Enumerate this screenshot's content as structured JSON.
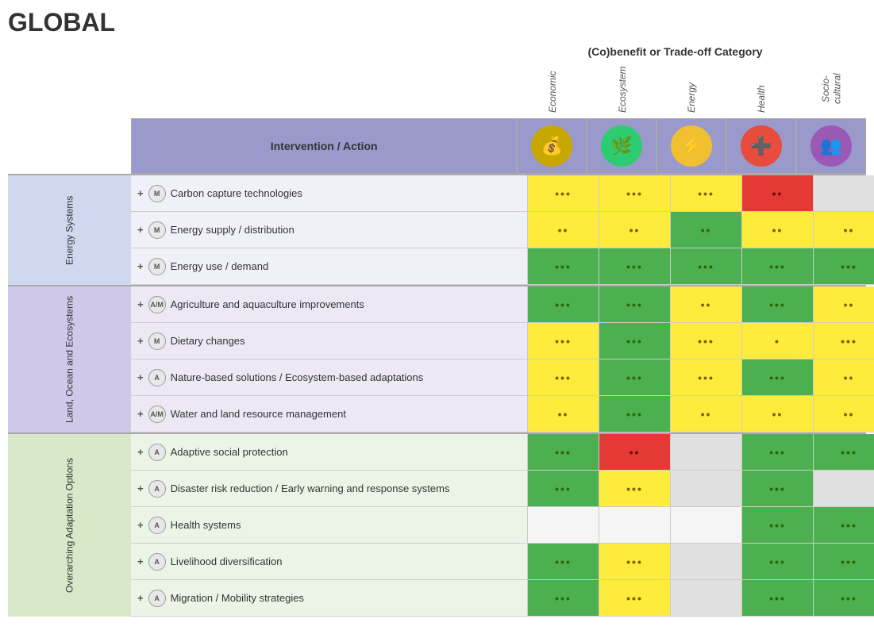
{
  "title": "GLOBAL",
  "cobenefit_label": "(Co)benefit or Trade-off Category",
  "col_headers": [
    "Economic",
    "Ecosystem",
    "Energy",
    "Health",
    "Socio-\ncultural"
  ],
  "header_row": {
    "action_label": "Intervention / Action",
    "icons": [
      "💰",
      "🌿",
      "⚡",
      "➕",
      "👥"
    ]
  },
  "sections": [
    {
      "label": "Energy Systems",
      "class": "section-energy",
      "action_class": "",
      "rows": [
        {
          "plus": "+",
          "badge": "M",
          "action": "Carbon capture technologies",
          "cells": [
            {
              "dots": "•••",
              "class": "cell-yellow"
            },
            {
              "dots": "•••",
              "class": "cell-yellow"
            },
            {
              "dots": "•••",
              "class": "cell-yellow"
            },
            {
              "dots": "••",
              "class": "cell-red"
            },
            {
              "dots": "",
              "class": "cell-gray"
            }
          ]
        },
        {
          "plus": "+",
          "badge": "M",
          "action": "Energy supply / distribution",
          "cells": [
            {
              "dots": "••",
              "class": "cell-yellow"
            },
            {
              "dots": "••",
              "class": "cell-yellow"
            },
            {
              "dots": "••",
              "class": "cell-green-dark"
            },
            {
              "dots": "••",
              "class": "cell-yellow"
            },
            {
              "dots": "••",
              "class": "cell-yellow"
            }
          ]
        },
        {
          "plus": "+",
          "badge": "M",
          "action": "Energy use / demand",
          "cells": [
            {
              "dots": "•••",
              "class": "cell-green-dark"
            },
            {
              "dots": "•••",
              "class": "cell-green-dark"
            },
            {
              "dots": "•••",
              "class": "cell-green-dark"
            },
            {
              "dots": "•••",
              "class": "cell-green-dark"
            },
            {
              "dots": "•••",
              "class": "cell-green-dark"
            }
          ]
        }
      ]
    },
    {
      "label": "Land, Ocean and Ecosystems",
      "class": "section-land",
      "action_class": "action-cell-land",
      "rows": [
        {
          "plus": "+",
          "badge": "A/M",
          "action": "Agriculture and aquaculture improvements",
          "cells": [
            {
              "dots": "•••",
              "class": "cell-green-dark"
            },
            {
              "dots": "•••",
              "class": "cell-green-dark"
            },
            {
              "dots": "••",
              "class": "cell-yellow"
            },
            {
              "dots": "•••",
              "class": "cell-green-dark"
            },
            {
              "dots": "••",
              "class": "cell-yellow"
            }
          ]
        },
        {
          "plus": "+",
          "badge": "M",
          "action": "Dietary changes",
          "cells": [
            {
              "dots": "•••",
              "class": "cell-yellow"
            },
            {
              "dots": "•••",
              "class": "cell-green-dark"
            },
            {
              "dots": "•••",
              "class": "cell-yellow"
            },
            {
              "dots": "•",
              "class": "cell-yellow"
            },
            {
              "dots": "•••",
              "class": "cell-yellow"
            }
          ]
        },
        {
          "plus": "+",
          "badge": "A",
          "action": "Nature-based solutions / Ecosystem-based adaptations",
          "cells": [
            {
              "dots": "•••",
              "class": "cell-yellow"
            },
            {
              "dots": "•••",
              "class": "cell-green-dark"
            },
            {
              "dots": "•••",
              "class": "cell-yellow"
            },
            {
              "dots": "•••",
              "class": "cell-green-dark"
            },
            {
              "dots": "••",
              "class": "cell-yellow"
            }
          ]
        },
        {
          "plus": "+",
          "badge": "A/M",
          "action": "Water and land resource management",
          "cells": [
            {
              "dots": "••",
              "class": "cell-yellow"
            },
            {
              "dots": "•••",
              "class": "cell-green-dark"
            },
            {
              "dots": "••",
              "class": "cell-yellow"
            },
            {
              "dots": "••",
              "class": "cell-yellow"
            },
            {
              "dots": "••",
              "class": "cell-yellow"
            }
          ]
        }
      ]
    },
    {
      "label": "Overarching Adaptation Options",
      "class": "section-overarching",
      "action_class": "action-cell-overarching",
      "rows": [
        {
          "plus": "+",
          "badge": "A",
          "action": "Adaptive social protection",
          "cells": [
            {
              "dots": "•••",
              "class": "cell-green-dark"
            },
            {
              "dots": "••",
              "class": "cell-red"
            },
            {
              "dots": "",
              "class": "cell-gray"
            },
            {
              "dots": "•••",
              "class": "cell-green-dark"
            },
            {
              "dots": "•••",
              "class": "cell-green-dark"
            }
          ]
        },
        {
          "plus": "+",
          "badge": "A",
          "action": "Disaster risk reduction / Early warning and response systems",
          "cells": [
            {
              "dots": "•••",
              "class": "cell-green-dark"
            },
            {
              "dots": "•••",
              "class": "cell-yellow"
            },
            {
              "dots": "",
              "class": "cell-gray"
            },
            {
              "dots": "•••",
              "class": "cell-green-dark"
            },
            {
              "dots": "",
              "class": "cell-gray"
            }
          ]
        },
        {
          "plus": "+",
          "badge": "A",
          "action": "Health systems",
          "cells": [
            {
              "dots": "",
              "class": "cell-empty"
            },
            {
              "dots": "",
              "class": "cell-empty"
            },
            {
              "dots": "",
              "class": "cell-empty"
            },
            {
              "dots": "•••",
              "class": "cell-green-dark"
            },
            {
              "dots": "•••",
              "class": "cell-green-dark"
            }
          ]
        },
        {
          "plus": "+",
          "badge": "A",
          "action": "Livelihood diversification",
          "cells": [
            {
              "dots": "•••",
              "class": "cell-green-dark"
            },
            {
              "dots": "•••",
              "class": "cell-yellow"
            },
            {
              "dots": "",
              "class": "cell-gray"
            },
            {
              "dots": "•••",
              "class": "cell-green-dark"
            },
            {
              "dots": "•••",
              "class": "cell-green-dark"
            }
          ]
        },
        {
          "plus": "+",
          "badge": "A",
          "action": "Migration / Mobility strategies",
          "cells": [
            {
              "dots": "•••",
              "class": "cell-green-dark"
            },
            {
              "dots": "•••",
              "class": "cell-yellow"
            },
            {
              "dots": "",
              "class": "cell-gray"
            },
            {
              "dots": "•••",
              "class": "cell-green-dark"
            },
            {
              "dots": "•••",
              "class": "cell-green-dark"
            }
          ]
        }
      ]
    }
  ]
}
